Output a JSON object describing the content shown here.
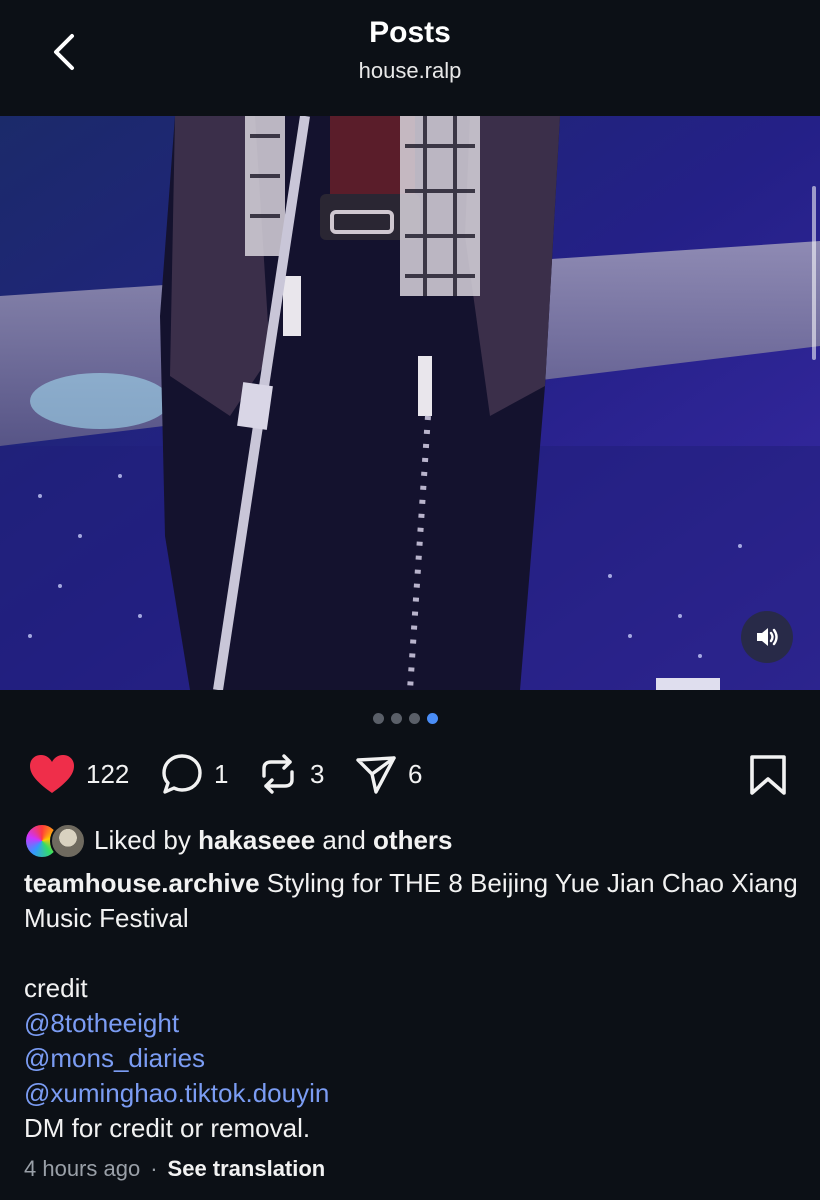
{
  "header": {
    "title": "Posts",
    "subtitle": "house.ralp"
  },
  "media": {
    "page_count": 4,
    "active_page": 4
  },
  "actions": {
    "likes": "122",
    "comments": "1",
    "reposts": "3",
    "shares": "6",
    "liked": true
  },
  "liked_by": {
    "prefix": "Liked by",
    "user": "hakaseee",
    "and": "and",
    "others": "others"
  },
  "caption": {
    "username": "teamhouse.archive",
    "text": " Styling for THE 8 Beijing Yue Jian Chao Xiang Music Festival",
    "credit_label": "credit",
    "mentions": [
      "@8totheeight",
      "@mons_diaries",
      "@xuminghao.tiktok.douyin"
    ],
    "footer": "DM for credit or removal."
  },
  "meta": {
    "time": "4 hours ago",
    "separator": "·",
    "translate": "See translation"
  },
  "colors": {
    "background": "#0c1016",
    "like": "#ef2e4a",
    "link": "#7b9cf3",
    "active_dot": "#4a8df6"
  }
}
